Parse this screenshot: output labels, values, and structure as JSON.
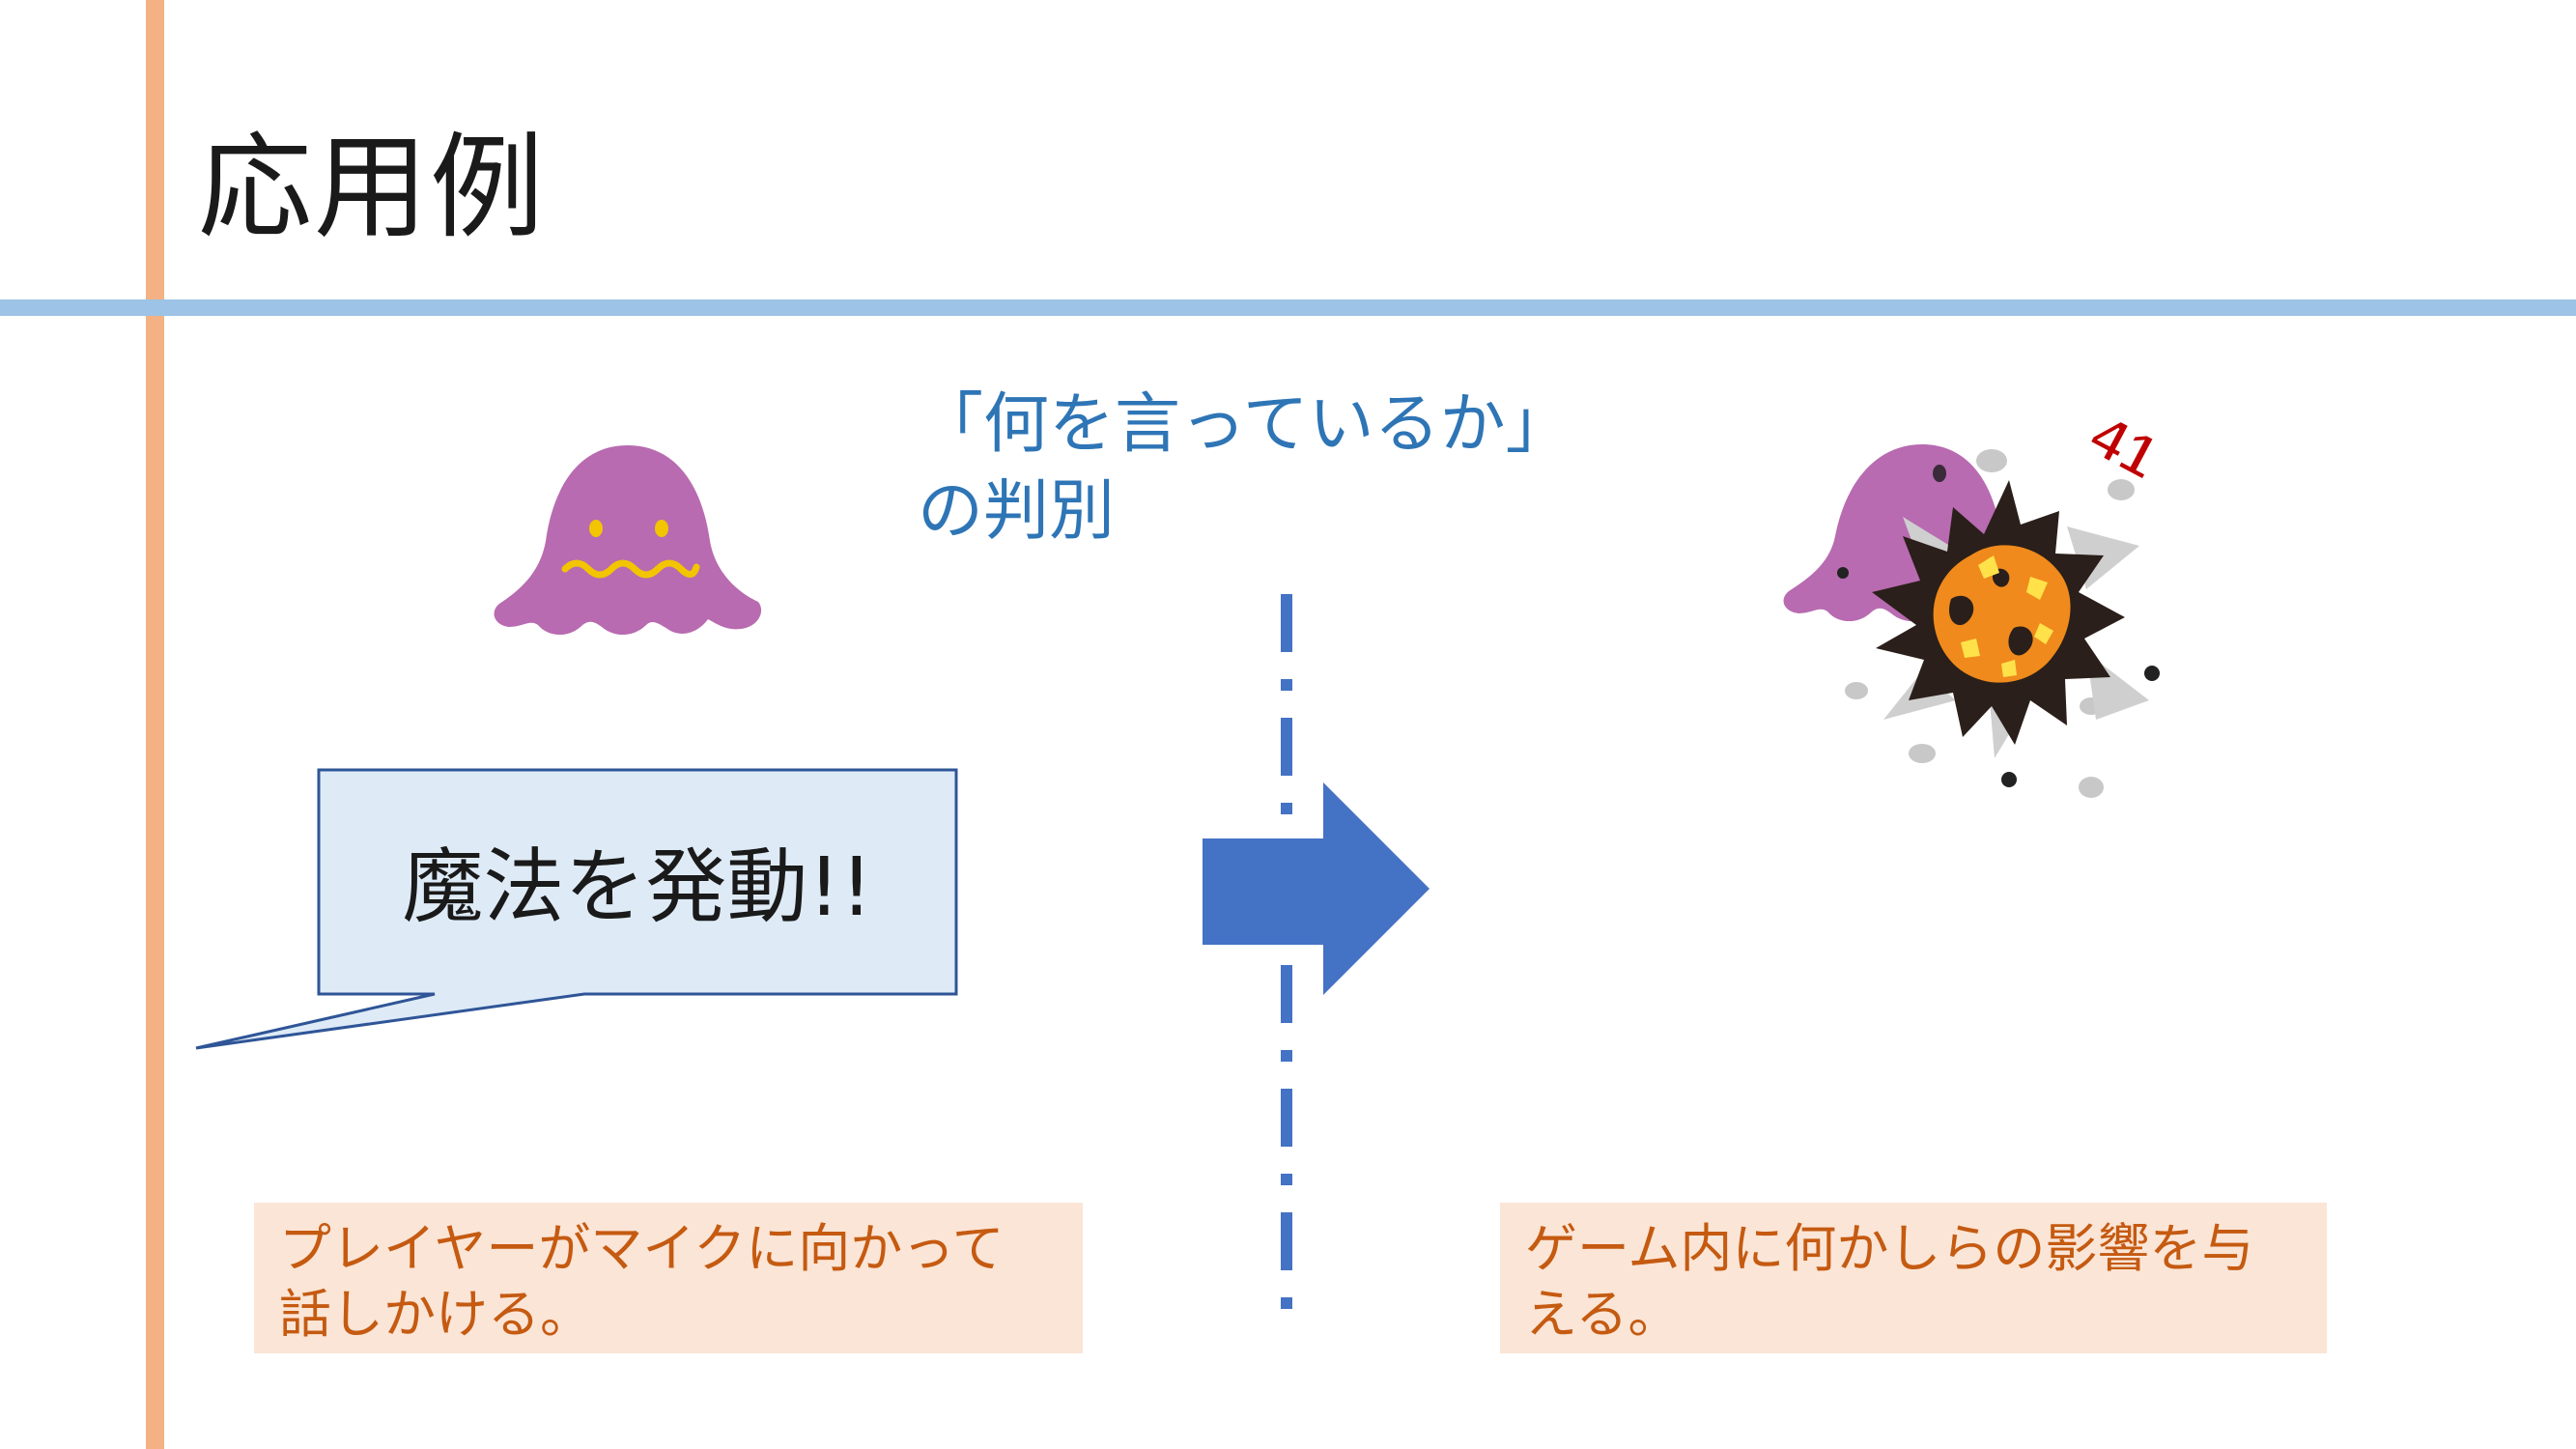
{
  "slide": {
    "title": "応用例",
    "caption": {
      "line1": "「何を言っているか」",
      "line2": "の判別"
    },
    "speech": "魔法を発動!!",
    "damage": "41",
    "note_left": {
      "line1": "プレイヤーがマイクに向かって",
      "line2": "話しかける。"
    },
    "note_right": {
      "line1": "ゲーム内に何かしらの影響を与",
      "line2": "える。"
    }
  },
  "colors": {
    "accent_vertical": "#f4b183",
    "accent_horizontal": "#9dc3e6",
    "caption_blue": "#2e75b6",
    "bubble_fill": "#deebf7",
    "bubble_stroke": "#2f5597",
    "arrow": "#4472c4",
    "note_fill": "#fbe5d6",
    "note_text": "#c55a11",
    "monster": "#b86bb0",
    "damage_red": "#c00000"
  },
  "icons": [
    "monster-icon",
    "explosion-icon",
    "arrow-right-icon"
  ]
}
